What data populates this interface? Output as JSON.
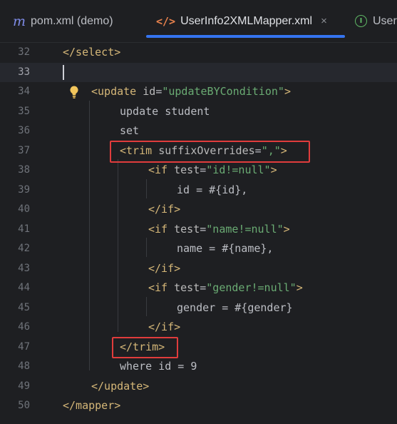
{
  "tabs": [
    {
      "label": "pom.xml (demo)",
      "icon": "maven-m-icon"
    },
    {
      "label": "UserInfo2XMLMapper.xml",
      "icon": "xml-tag-icon",
      "active": true
    },
    {
      "label": "UserI",
      "icon": "interface-i-icon"
    }
  ],
  "tab_icons": {
    "maven": "m",
    "xml": "</>",
    "interface": "I",
    "close": "×"
  },
  "colors": {
    "tag": "#d5b778",
    "attribute": "#bababa",
    "string": "#6aab73",
    "highlight_box": "#e03c3c",
    "tab_underline": "#3574f0"
  },
  "editor": {
    "current_line": 33,
    "lines": [
      {
        "num": "32",
        "tokens": [
          {
            "t": "</select>",
            "c": "tg"
          }
        ]
      },
      {
        "num": "33",
        "tokens": []
      },
      {
        "num": "34",
        "tokens": [
          {
            "t": "<update ",
            "c": "tg"
          },
          {
            "t": "id",
            "c": "at"
          },
          {
            "t": "=",
            "c": "txt"
          },
          {
            "t": "\"updateBYCondition\"",
            "c": "str"
          },
          {
            "t": ">",
            "c": "tg"
          }
        ]
      },
      {
        "num": "35",
        "tokens": [
          {
            "t": "update student",
            "c": "txt"
          }
        ]
      },
      {
        "num": "36",
        "tokens": [
          {
            "t": "set",
            "c": "txt"
          }
        ]
      },
      {
        "num": "37",
        "tokens": [
          {
            "t": "<trim ",
            "c": "tg"
          },
          {
            "t": "suffixOverrides",
            "c": "at"
          },
          {
            "t": "=",
            "c": "txt"
          },
          {
            "t": "\",\"",
            "c": "str"
          },
          {
            "t": ">",
            "c": "tg"
          }
        ]
      },
      {
        "num": "38",
        "tokens": [
          {
            "t": "<if ",
            "c": "tg"
          },
          {
            "t": "test",
            "c": "at"
          },
          {
            "t": "=",
            "c": "txt"
          },
          {
            "t": "\"id!=null\"",
            "c": "str"
          },
          {
            "t": ">",
            "c": "tg"
          }
        ]
      },
      {
        "num": "39",
        "tokens": [
          {
            "t": "id = #{id},",
            "c": "txt"
          }
        ]
      },
      {
        "num": "40",
        "tokens": [
          {
            "t": "</if>",
            "c": "tg"
          }
        ]
      },
      {
        "num": "41",
        "tokens": [
          {
            "t": "<if ",
            "c": "tg"
          },
          {
            "t": "test",
            "c": "at"
          },
          {
            "t": "=",
            "c": "txt"
          },
          {
            "t": "\"name!=null\"",
            "c": "str"
          },
          {
            "t": ">",
            "c": "tg"
          }
        ]
      },
      {
        "num": "42",
        "tokens": [
          {
            "t": "name = #{name},",
            "c": "txt"
          }
        ]
      },
      {
        "num": "43",
        "tokens": [
          {
            "t": "</if>",
            "c": "tg"
          }
        ]
      },
      {
        "num": "44",
        "tokens": [
          {
            "t": "<if ",
            "c": "tg"
          },
          {
            "t": "test",
            "c": "at"
          },
          {
            "t": "=",
            "c": "txt"
          },
          {
            "t": "\"gender!=null\"",
            "c": "str"
          },
          {
            "t": ">",
            "c": "tg"
          }
        ]
      },
      {
        "num": "45",
        "tokens": [
          {
            "t": "gender = #{gender}",
            "c": "txt"
          }
        ]
      },
      {
        "num": "46",
        "tokens": [
          {
            "t": "</if>",
            "c": "tg"
          }
        ]
      },
      {
        "num": "47",
        "tokens": [
          {
            "t": "</trim>",
            "c": "tg"
          }
        ]
      },
      {
        "num": "48",
        "tokens": [
          {
            "t": "where id = 9",
            "c": "txt"
          }
        ]
      },
      {
        "num": "49",
        "tokens": [
          {
            "t": "</update>",
            "c": "tg"
          }
        ]
      },
      {
        "num": "50",
        "tokens": [
          {
            "t": "</mapper>",
            "c": "tg"
          }
        ]
      }
    ],
    "highlighted_lines": [
      37,
      47
    ]
  }
}
